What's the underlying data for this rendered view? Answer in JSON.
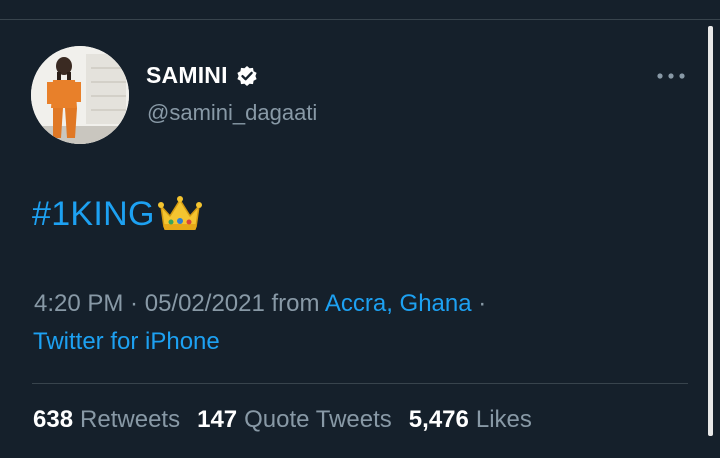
{
  "user": {
    "display_name": "SAMINI",
    "handle": "@samini_dagaati",
    "verified": true,
    "avatar_icon": "profile-photo"
  },
  "tweet": {
    "text": "#1KING",
    "emoji": "crown-emoji"
  },
  "meta": {
    "time": "4:20 PM",
    "separator": " · ",
    "date": "05/02/2021",
    "from_label": " from ",
    "location": "Accra, Ghana",
    "trailing_separator": " ·",
    "source": "Twitter for iPhone"
  },
  "stats": {
    "retweets_count": "638",
    "retweets_label": "Retweets",
    "quotes_count": "147",
    "quotes_label": "Quote Tweets",
    "likes_count": "5,476",
    "likes_label": "Likes"
  },
  "colors": {
    "background": "#15202b",
    "accent": "#1da1f2",
    "secondary_text": "#8899a6",
    "divider": "#38444d"
  }
}
